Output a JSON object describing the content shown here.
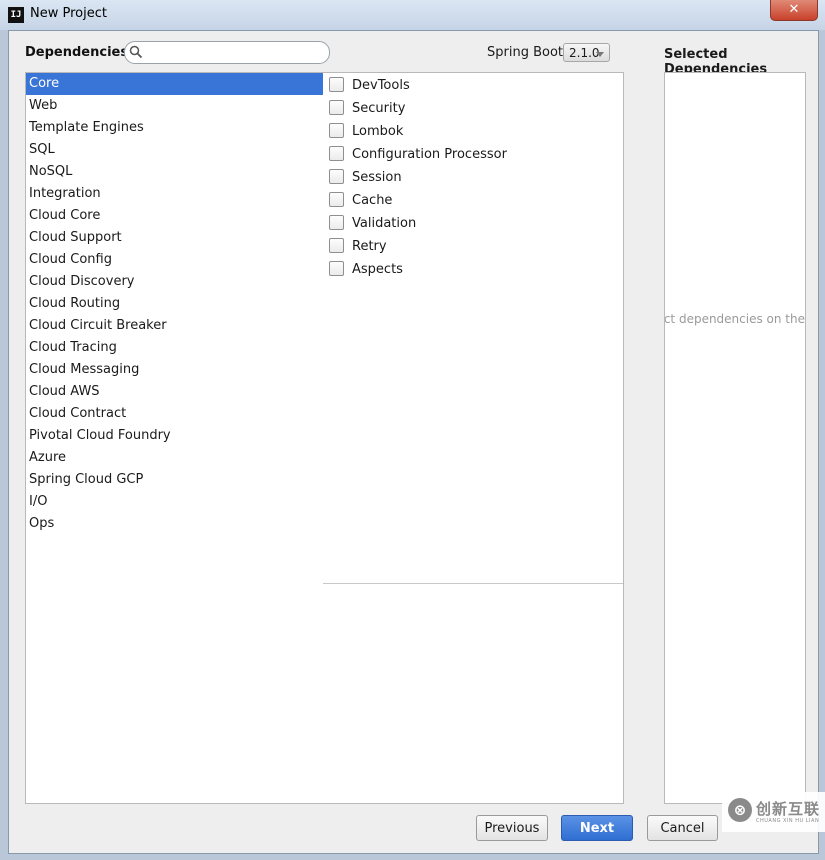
{
  "window": {
    "title": "New Project",
    "app_icon": "IJ",
    "close": "✕"
  },
  "header": {
    "dependencies_label": "Dependencies",
    "search_placeholder": "",
    "spring_boot_label": "Spring Boot",
    "spring_boot_version": "2.1.0"
  },
  "categories": [
    {
      "label": "Core",
      "selected": true
    },
    {
      "label": "Web"
    },
    {
      "label": "Template Engines"
    },
    {
      "label": "SQL"
    },
    {
      "label": "NoSQL"
    },
    {
      "label": "Integration"
    },
    {
      "label": "Cloud Core"
    },
    {
      "label": "Cloud Support"
    },
    {
      "label": "Cloud Config"
    },
    {
      "label": "Cloud Discovery"
    },
    {
      "label": "Cloud Routing"
    },
    {
      "label": "Cloud Circuit Breaker"
    },
    {
      "label": "Cloud Tracing"
    },
    {
      "label": "Cloud Messaging"
    },
    {
      "label": "Cloud AWS"
    },
    {
      "label": "Cloud Contract"
    },
    {
      "label": "Pivotal Cloud Foundry"
    },
    {
      "label": "Azure"
    },
    {
      "label": "Spring Cloud GCP"
    },
    {
      "label": "I/O"
    },
    {
      "label": "Ops"
    }
  ],
  "dependencies": [
    {
      "label": "DevTools",
      "checked": false
    },
    {
      "label": "Security",
      "checked": false
    },
    {
      "label": "Lombok",
      "checked": false
    },
    {
      "label": "Configuration Processor",
      "checked": false
    },
    {
      "label": "Session",
      "checked": false
    },
    {
      "label": "Cache",
      "checked": false
    },
    {
      "label": "Validation",
      "checked": false
    },
    {
      "label": "Retry",
      "checked": false
    },
    {
      "label": "Aspects",
      "checked": false
    }
  ],
  "selected_panel": {
    "title": "Selected Dependencies",
    "empty_text": "ect dependencies on the"
  },
  "buttons": {
    "previous": "Previous",
    "next": "Next",
    "cancel": "Cancel"
  },
  "watermark": {
    "logo": "⊗",
    "text": "创新互联",
    "sub": "CHUANG XIN HU LIAN"
  },
  "colors": {
    "selection": "#3875d7",
    "primary_button": "#3a78d8"
  }
}
